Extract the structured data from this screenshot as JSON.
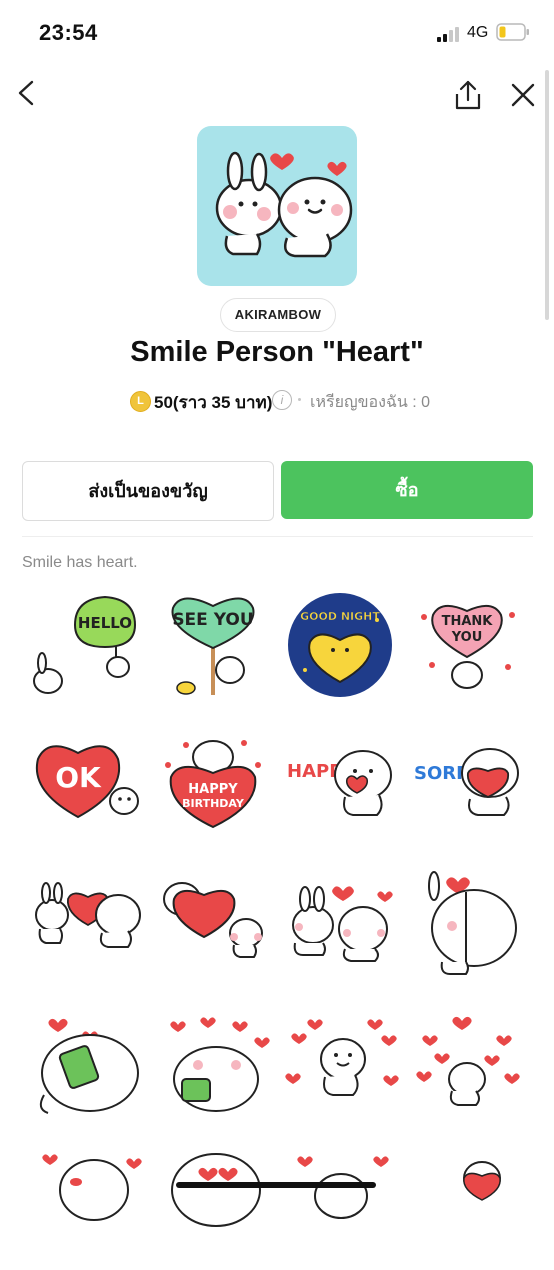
{
  "status_bar": {
    "time": "23:54",
    "network": "4G"
  },
  "pack": {
    "author": "AKIRAMBOW",
    "title": "Smile Person \"Heart\"",
    "coin_symbol": "L",
    "price": "50(ราว 35 บาท)",
    "my_coins": "เหรียญของฉัน : 0",
    "description": "Smile has heart."
  },
  "actions": {
    "gift_label": "ส่งเป็นของขวัญ",
    "buy_label": "ซื้อ"
  },
  "stickers": {
    "hello": "HELLO",
    "see_you": "SEE YOU",
    "good_night": "GOOD NIGHT",
    "thank_you_1": "THANK",
    "thank_you_2": "YOU",
    "ok": "OK",
    "happy_birthday_1": "HAPPY",
    "happy_birthday_2": "BIRTHDAY",
    "happy": "HAPPY",
    "sorry": "SORRY"
  },
  "colors": {
    "buy": "#4cc35e",
    "hero_bg": "#a9e3ea",
    "heart": "#e84848",
    "coin": "#f0c43a"
  }
}
